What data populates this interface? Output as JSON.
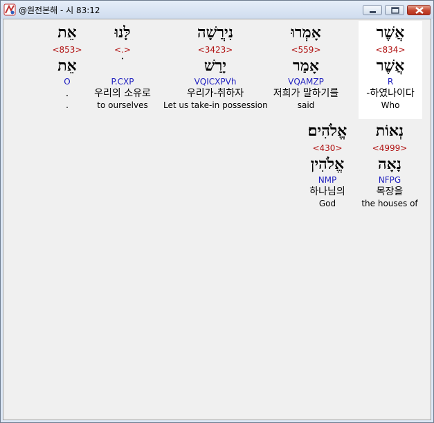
{
  "window": {
    "title": "@원전본해 - 시 83:12",
    "minimize_icon": "minimize-icon",
    "maximize_icon": "maximize-icon",
    "close_icon": "close-icon",
    "app_icon": "app-icon"
  },
  "words": [
    {
      "hebrew": "אֲשֶׁר",
      "strong": "<834>",
      "lemma": "אֲשֶׁר",
      "morph": "R",
      "korean": "-하였나이다",
      "english": "Who",
      "selected": true
    },
    {
      "hebrew": "אָמְרוּ",
      "strong": "<559>",
      "lemma": "אָמַר",
      "morph": "VQAMZP",
      "korean": "저희가 말하기를",
      "english": "said"
    },
    {
      "hebrew": "נִירֲשָׁה",
      "strong": "<3423>",
      "lemma": "יָרַשׁ",
      "morph": "VQICXPVh",
      "korean": "우리가-취하자",
      "english": "Let us take-in possession"
    },
    {
      "hebrew": "לָּנוּ",
      "strong": "<.>",
      "lemma": "ׄ",
      "morph": "P.CXP",
      "korean": "우리의 소유로",
      "english": "to ourselves"
    },
    {
      "hebrew": "אֵת",
      "strong": "<853>",
      "lemma": "אֵת",
      "morph": "O",
      "korean": ".",
      "english": "."
    },
    {
      "hebrew": "נְאוֹת",
      "strong": "<4999>",
      "lemma": "נָאָה",
      "morph": "NFPG",
      "korean": "목장을",
      "english": "the houses of"
    },
    {
      "hebrew": "אֱלֹהִים׃",
      "strong": "<430>",
      "lemma": "אֱלֹהִין",
      "morph": "NMP",
      "korean": "하나님의",
      "english": "God"
    }
  ],
  "colors": {
    "strong_number": "#b01010",
    "morphology": "#2020c0",
    "background": "#f0f0f0",
    "selected": "#ffffff"
  }
}
